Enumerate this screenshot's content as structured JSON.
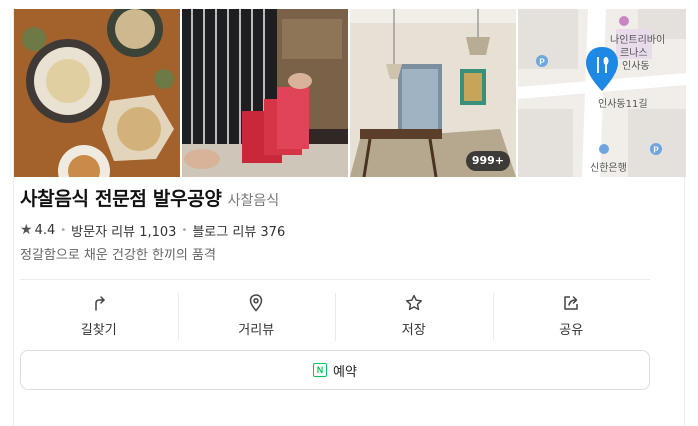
{
  "photos": {
    "more_count": "999+"
  },
  "map": {
    "labels": [
      "나인트리바이",
      "르나스",
      "인사동",
      "인사동11길",
      "신한은행"
    ]
  },
  "place": {
    "name": "사찰음식 전문점 발우공양",
    "category": "사찰음식",
    "rating": "4.4",
    "visitor_reviews": "방문자 리뷰 1,103",
    "blog_reviews": "블로그 리뷰 376",
    "description": "정갈함으로 채운 건강한 한끼의 품격"
  },
  "actions": {
    "directions": "길찾기",
    "street_view": "거리뷰",
    "save": "저장",
    "share": "공유"
  },
  "reserve": {
    "label": "예약",
    "badge": "N"
  },
  "colors": {
    "naver_green": "#03c75a",
    "map_pin": "#1e88e5"
  }
}
